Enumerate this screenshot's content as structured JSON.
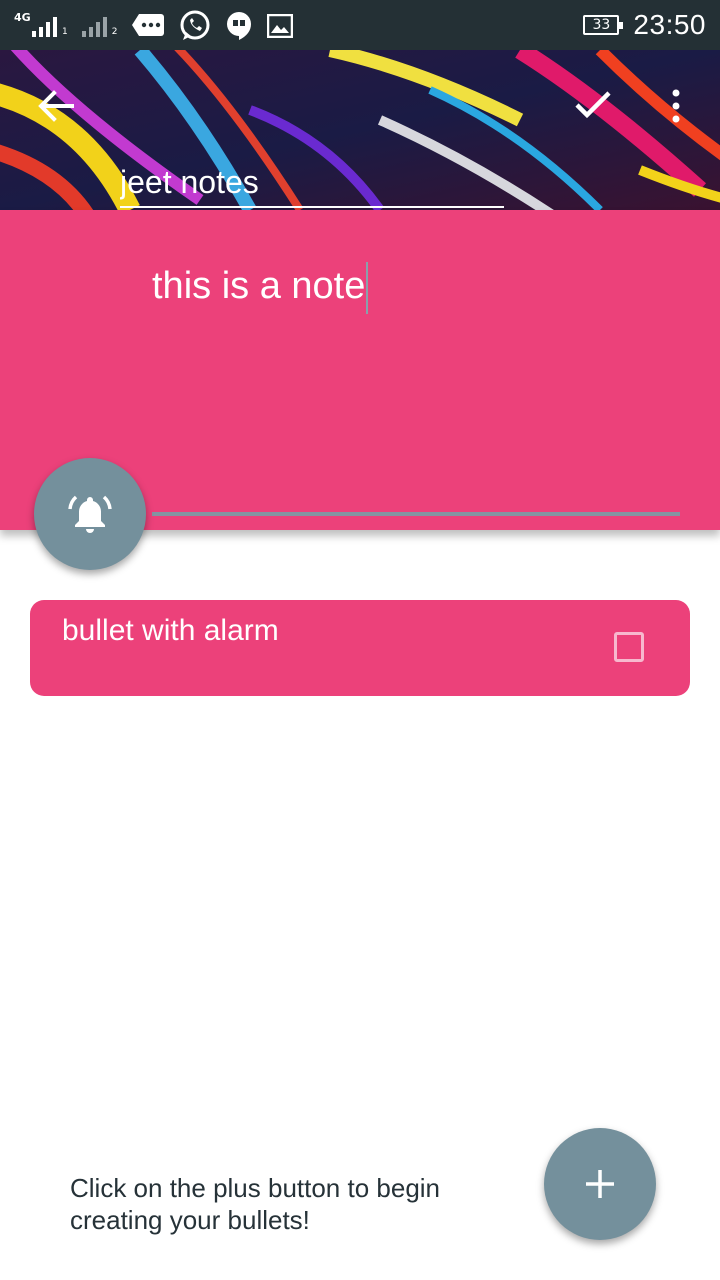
{
  "status_bar": {
    "network_type": "4G",
    "sim1_sub": "1",
    "sim2_sub": "2",
    "battery_level": "33",
    "time": "23:50"
  },
  "header": {
    "back_icon": "arrow-left-icon",
    "title_value": "jeet notes",
    "confirm_icon": "check-icon",
    "more_icon": "more-vert-icon"
  },
  "note": {
    "text": "this is a note"
  },
  "alarm_button": {
    "icon": "bell-ringing-icon"
  },
  "bullets": [
    {
      "label": "bullet with alarm",
      "checked": false
    }
  ],
  "hint": {
    "text": "Click on the plus button to begin creating your bullets!"
  },
  "add_button": {
    "icon": "plus-icon"
  },
  "colors": {
    "accent": "#ec417a",
    "fab": "#74909c",
    "status_bar": "#243035"
  }
}
